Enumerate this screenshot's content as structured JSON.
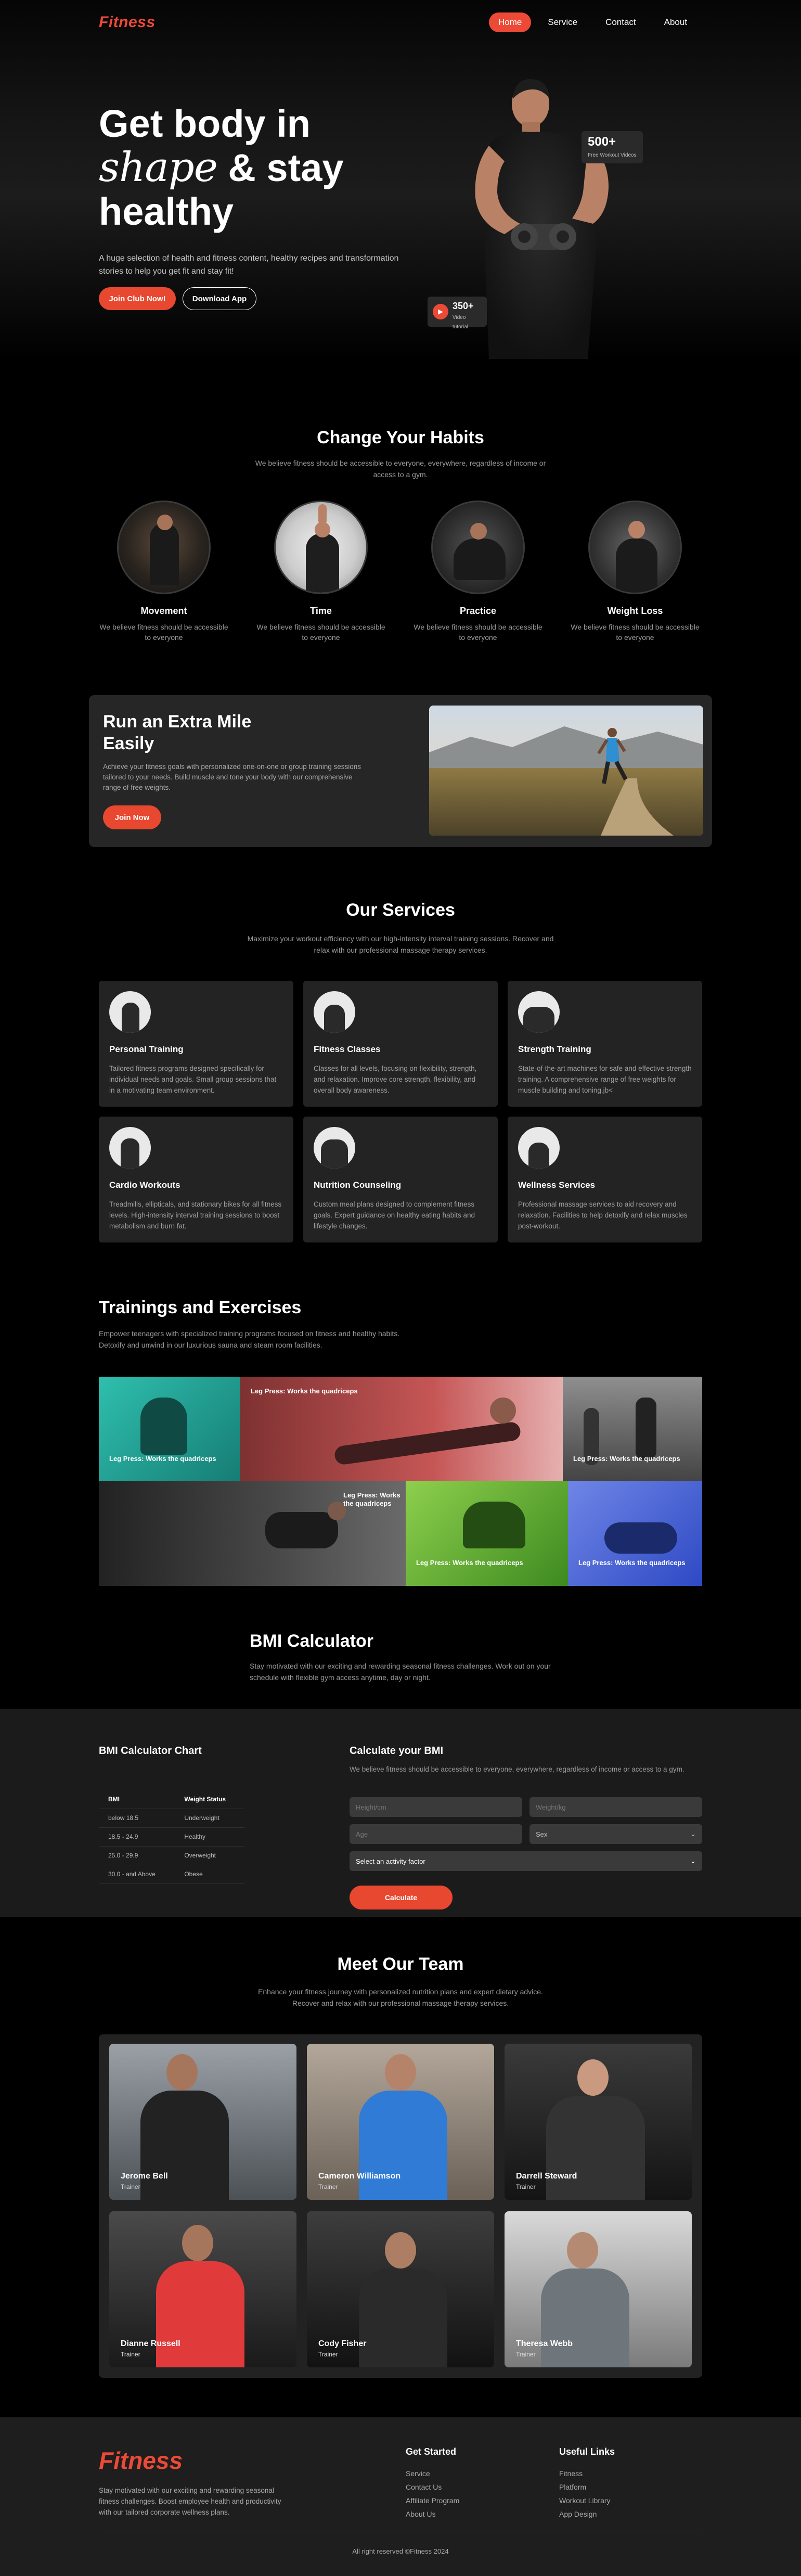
{
  "nav": {
    "logo": "Fitness",
    "links": [
      "Home",
      "Service",
      "Contact",
      "About"
    ]
  },
  "hero": {
    "title_1": "Get body in",
    "title_script": "shape",
    "title_2": "& stay",
    "title_3": "healthy",
    "subtitle": "A huge selection of health and fitness content, healthy recipes and transformation stories to help you get fit and stay fit!",
    "btn_join": "Join Club Now!",
    "btn_download": "Download App",
    "stat1_value": "500+",
    "stat1_label": "Free Workout Videos",
    "stat2_value": "350+",
    "stat2_label": "Video tutorial"
  },
  "habits": {
    "title": "Change Your Habits",
    "subtitle": "We believe fitness should be accessible to everyone, everywhere, regardless of income or access to a gym.",
    "items": [
      {
        "title": "Movement",
        "desc": "We believe fitness should be accessible to everyone"
      },
      {
        "title": "Time",
        "desc": "We believe fitness should be accessible to everyone"
      },
      {
        "title": "Practice",
        "desc": "We believe fitness should be accessible to everyone"
      },
      {
        "title": "Weight Loss",
        "desc": "We believe fitness should be accessible to everyone"
      }
    ]
  },
  "run": {
    "title": "Run an Extra Mile Easily",
    "desc": "Achieve your fitness goals with personalized one-on-one or group training sessions tailored to your needs. Build muscle and tone your body with our comprehensive range of free weights.",
    "button": "Join Now"
  },
  "services": {
    "title": "Our Services",
    "subtitle": "Maximize your workout efficiency with our high-intensity interval training sessions. Recover and relax with our professional massage therapy services.",
    "items": [
      {
        "title": "Personal Training",
        "desc": "Tailored fitness programs designed specifically for individual needs and goals. Small group sessions that in a motivating team environment."
      },
      {
        "title": "Fitness Classes",
        "desc": "Classes for all levels, focusing on flexibility, strength, and relaxation. Improve core strength, flexibility, and overall body awareness."
      },
      {
        "title": "Strength Training",
        "desc": "State-of-the-art machines for safe and effective strength training. A comprehensive range of free weights for muscle building and toning.jb<"
      },
      {
        "title": "Cardio Workouts",
        "desc": "Treadmills, ellipticals, and stationary bikes for all fitness levels. High-intensity interval training sessions to boost metabolism and burn fat."
      },
      {
        "title": "Nutrition Counseling",
        "desc": "Custom meal plans designed to complement fitness goals. Expert guidance on healthy eating habits and lifestyle changes."
      },
      {
        "title": "Wellness Services",
        "desc": "Professional massage services to aid recovery and relaxation. Facilities to help detoxify and relax muscles post-workout."
      }
    ]
  },
  "trainings": {
    "title": "Trainings and Exercises",
    "subtitle": "Empower teenagers with specialized training programs focused on fitness and healthy habits. Detoxify and unwind in our luxurious sauna and steam room facilities.",
    "caption": "Leg Press: Works the quadriceps"
  },
  "bmi": {
    "title": "BMI Calculator",
    "subtitle": "Stay motivated with our exciting and rewarding seasonal fitness challenges. Work out on your schedule with flexible gym access anytime, day or night.",
    "chart_title": "BMI Calculator Chart",
    "table_headers": [
      "BMI",
      "Weight Status"
    ],
    "table_rows": [
      [
        "below 18.5",
        "Underweight"
      ],
      [
        "18.5 - 24.9",
        "Healthy"
      ],
      [
        "25.0 - 29.9",
        "Overweight"
      ],
      [
        "30.0 - and Above",
        "Obese"
      ]
    ],
    "calc_title": "Calculate your BMI",
    "calc_desc": "We believe fitness should be accessible to everyone, everywhere, regardless of income or access to a gym.",
    "height_placeholder": "Height/cm",
    "weight_placeholder": "Weight/kg",
    "age_placeholder": "Age",
    "sex_label": "Sex",
    "activity_label": "Select an activity factor",
    "calc_button": "Calculate"
  },
  "team": {
    "title": "Meet Our Team",
    "subtitle": "Enhance your fitness journey with personalized nutrition plans and expert dietary advice. Recover and relax with our professional massage therapy services.",
    "members": [
      {
        "name": "Jerome Bell",
        "role": "Trainer"
      },
      {
        "name": "Cameron Williamson",
        "role": "Trainer"
      },
      {
        "name": "Darrell Steward",
        "role": "Trainer"
      },
      {
        "name": "Dianne Russell",
        "role": "Trainer"
      },
      {
        "name": "Cody Fisher",
        "role": "Trainer"
      },
      {
        "name": "Theresa Webb",
        "role": "Trainer"
      }
    ]
  },
  "footer": {
    "logo": "Fitness",
    "desc": "Stay motivated with our exciting and rewarding seasonal fitness challenges. Boost employee health and productivity with our tailored corporate wellness plans.",
    "col1_title": "Get Started",
    "col1_links": [
      "Service",
      "Contact Us",
      "Affiliate Program",
      "About Us"
    ],
    "col2_title": "Useful Links",
    "col2_links": [
      "Fitness",
      "Platform",
      "Workout Library",
      "App Design"
    ],
    "copyright": "All right reserved ©Fitness 2024"
  },
  "colors": {
    "accent": "#ec4a37",
    "card": "#232323",
    "background": "#000000"
  }
}
